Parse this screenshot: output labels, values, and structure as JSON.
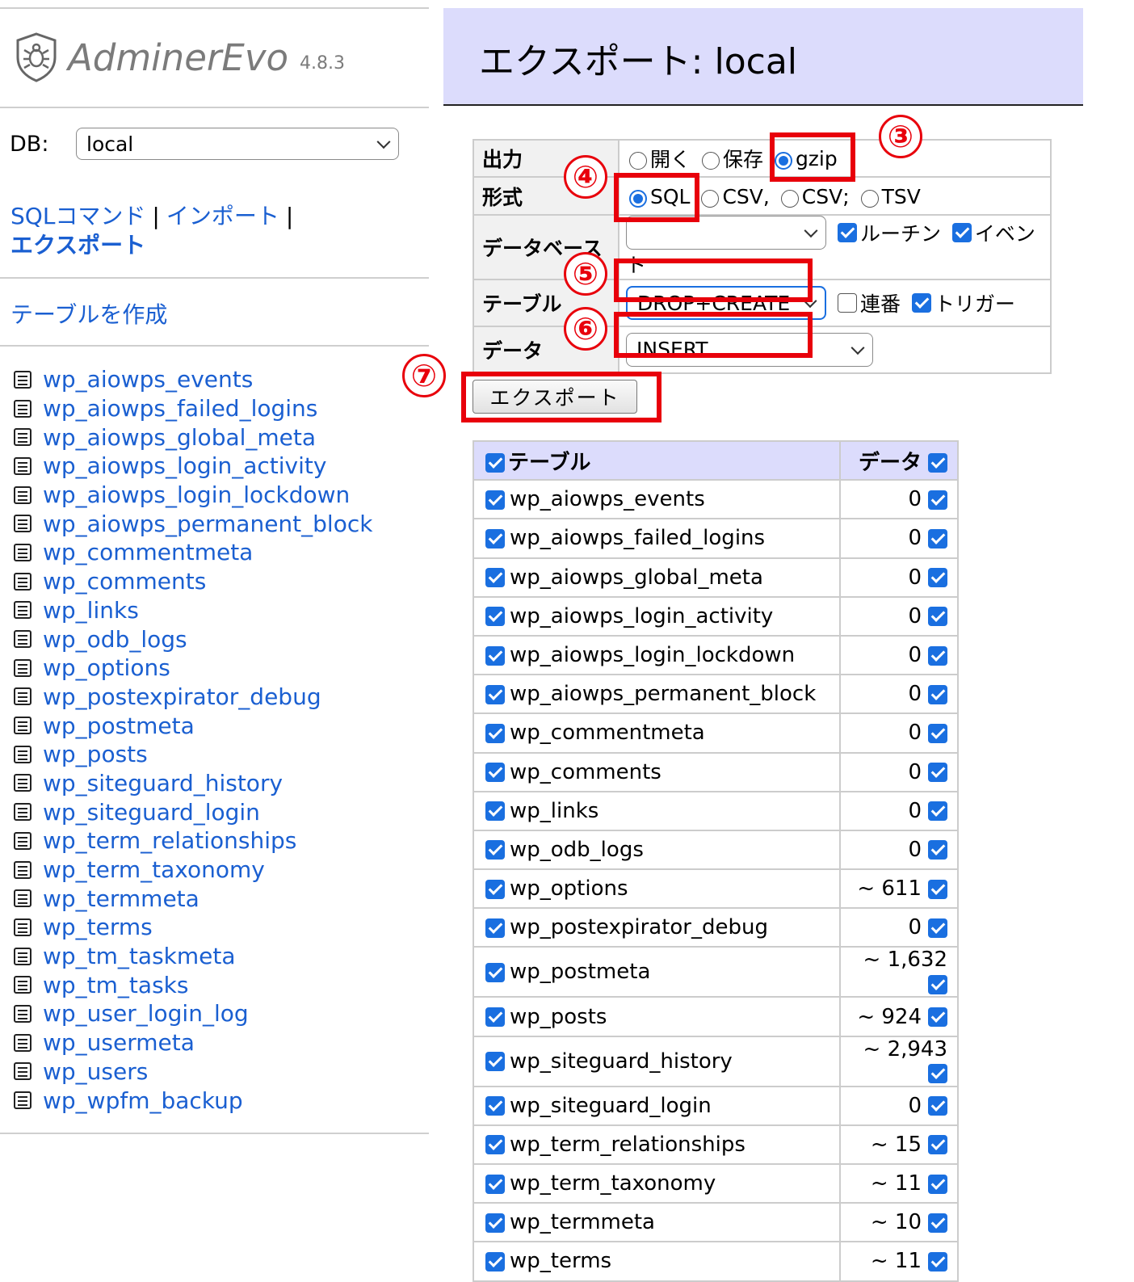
{
  "app": {
    "name": "AdminerEvo",
    "version": "4.8.3"
  },
  "db": {
    "label": "DB:",
    "selected": "local"
  },
  "nav": {
    "sql_command": "SQLコマンド",
    "import": "インポート",
    "separator": "|",
    "export": "エクスポート",
    "create_table": "テーブルを作成"
  },
  "sidebar_tables": [
    "wp_aiowps_events",
    "wp_aiowps_failed_logins",
    "wp_aiowps_global_meta",
    "wp_aiowps_login_activity",
    "wp_aiowps_login_lockdown",
    "wp_aiowps_permanent_block",
    "wp_commentmeta",
    "wp_comments",
    "wp_links",
    "wp_odb_logs",
    "wp_options",
    "wp_postexpirator_debug",
    "wp_postmeta",
    "wp_posts",
    "wp_siteguard_history",
    "wp_siteguard_login",
    "wp_term_relationships",
    "wp_term_taxonomy",
    "wp_termmeta",
    "wp_terms",
    "wp_tm_taskmeta",
    "wp_tm_tasks",
    "wp_user_login_log",
    "wp_usermeta",
    "wp_users",
    "wp_wpfm_backup"
  ],
  "page": {
    "title": "エクスポート: local"
  },
  "options": {
    "output": {
      "label": "出力",
      "choices": [
        "開く",
        "保存",
        "gzip"
      ],
      "selected": "gzip"
    },
    "format": {
      "label": "形式",
      "choices": [
        "SQL",
        "CSV,",
        "CSV;",
        "TSV"
      ],
      "selected": "SQL"
    },
    "database": {
      "label": "データベース",
      "value": "",
      "routines": "ルーチン",
      "events": "イベント"
    },
    "table": {
      "label": "テーブル",
      "value": "DROP+CREATE",
      "auto_increment": "連番",
      "triggers": "トリガー"
    },
    "data": {
      "label": "データ",
      "value": "INSERT"
    }
  },
  "annotations": [
    "③",
    "④",
    "⑤",
    "⑥",
    "⑦"
  ],
  "export_button": "エクスポート",
  "tables_grid": {
    "header_table": "テーブル",
    "header_data": "データ",
    "rows": [
      {
        "name": "wp_aiowps_events",
        "data": "0"
      },
      {
        "name": "wp_aiowps_failed_logins",
        "data": "0"
      },
      {
        "name": "wp_aiowps_global_meta",
        "data": "0"
      },
      {
        "name": "wp_aiowps_login_activity",
        "data": "0"
      },
      {
        "name": "wp_aiowps_login_lockdown",
        "data": "0"
      },
      {
        "name": "wp_aiowps_permanent_block",
        "data": "0"
      },
      {
        "name": "wp_commentmeta",
        "data": "0"
      },
      {
        "name": "wp_comments",
        "data": "0"
      },
      {
        "name": "wp_links",
        "data": "0"
      },
      {
        "name": "wp_odb_logs",
        "data": "0"
      },
      {
        "name": "wp_options",
        "data": "~ 611"
      },
      {
        "name": "wp_postexpirator_debug",
        "data": "0"
      },
      {
        "name": "wp_postmeta",
        "data": "~ 1,632"
      },
      {
        "name": "wp_posts",
        "data": "~ 924"
      },
      {
        "name": "wp_siteguard_history",
        "data": "~ 2,943"
      },
      {
        "name": "wp_siteguard_login",
        "data": "0"
      },
      {
        "name": "wp_term_relationships",
        "data": "~ 15"
      },
      {
        "name": "wp_term_taxonomy",
        "data": "~ 11"
      },
      {
        "name": "wp_termmeta",
        "data": "~ 10"
      },
      {
        "name": "wp_terms",
        "data": "~ 11"
      }
    ]
  },
  "colors": {
    "link": "#1a5fd1",
    "accent": "#1a6fe0",
    "header_bg": "#dcdcfc",
    "highlight": "#e8000b"
  }
}
